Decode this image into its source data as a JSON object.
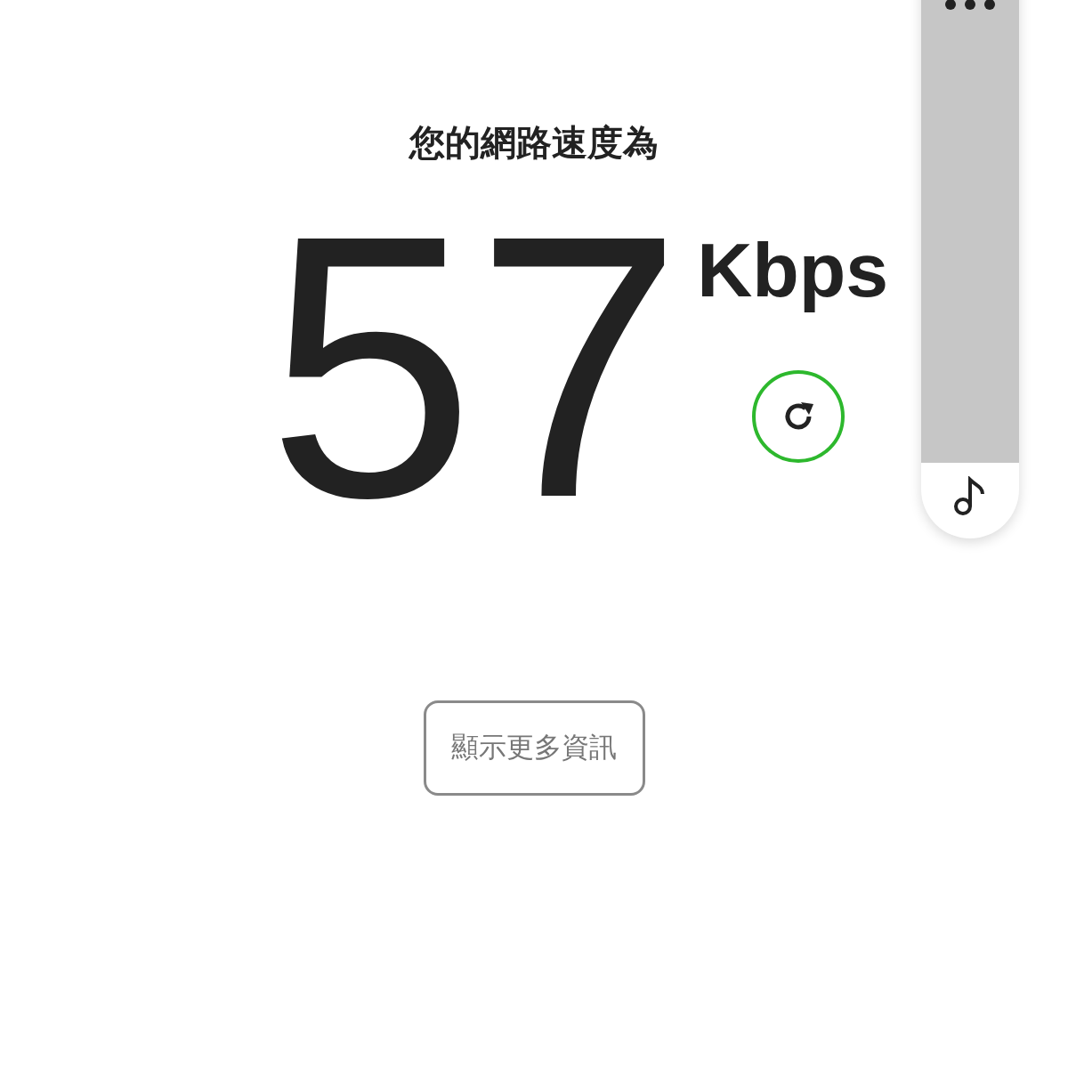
{
  "heading": "您的網路速度為",
  "speed": {
    "value": "57",
    "unit": "Kbps"
  },
  "more_button": {
    "label": "顯示更多資訊"
  },
  "volume_panel": {
    "level": 0
  }
}
